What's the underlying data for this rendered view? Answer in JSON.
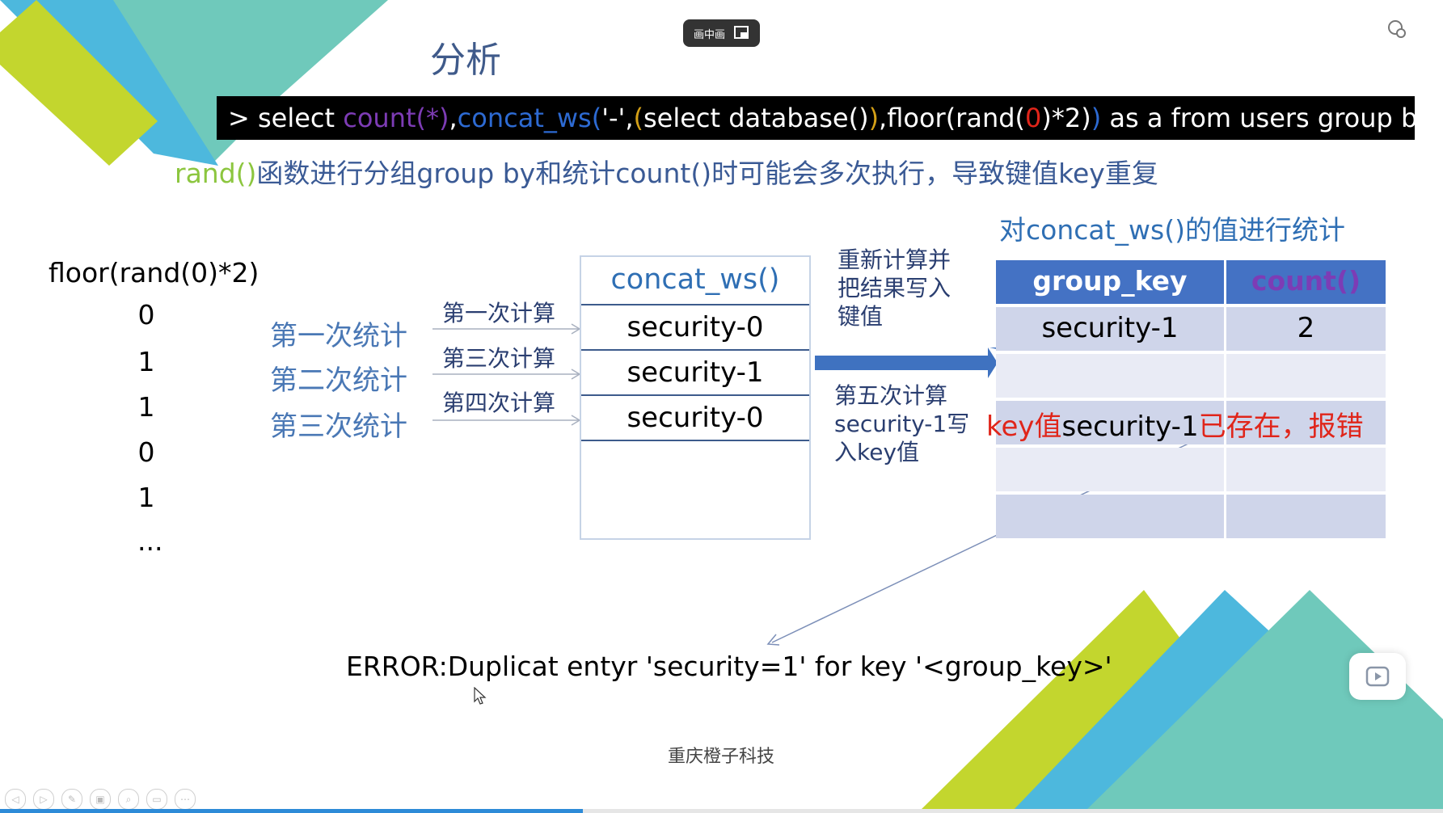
{
  "slide": {
    "title": "分析",
    "pip_label": "画中画",
    "sql": {
      "prefix": "> select ",
      "count": "count(*)",
      "comma1": ",",
      "concat": "concat_ws(",
      "sep": "'-',",
      "open": "(",
      "select_db": "select database()",
      "close": ")",
      "floor_a": ",floor(rand(",
      "zero": "0",
      "floor_b": ")*2)",
      "close2": ")",
      "suffix": " as a from users group by a;"
    },
    "subtitle_rand": "rand()",
    "subtitle_rest": "函数进行分组group by和统计count()时可能会多次执行，导致键值key重复",
    "floor_header": "floor(rand(0)*2)",
    "floor_values": [
      "0",
      "1",
      "1",
      "0",
      "1",
      "..."
    ],
    "stat_labels": [
      "第一次统计",
      "第二次统计",
      "第三次统计"
    ],
    "calc_labels": [
      "第一次计算",
      "第三次计算",
      "第四次计算"
    ],
    "concat_header": "concat_ws()",
    "concat_rows": [
      "security-0",
      "security-1",
      "security-0"
    ],
    "recalc_label_lines": [
      "重新计算并",
      "把结果写入",
      "键值"
    ],
    "fifth_calc_lines": [
      "第五次计算",
      "security-1写",
      "入key值"
    ],
    "table_title": "对concat_ws()的值进行统计",
    "table_headers": [
      "group_key",
      "count()"
    ],
    "table_rows": [
      [
        "security-1",
        "2"
      ]
    ],
    "key_exists": {
      "a": "key值",
      "b": "security-1",
      "c": "已存在，报错"
    },
    "error_text": "ERROR:Duplicat entyr 'security=1' for key '<group_key>'",
    "footer": "重庆橙子科技"
  },
  "colors": {
    "lime": "#c3d62e",
    "cyan": "#4db8dd",
    "teal": "#6fc9bb",
    "header_blue": "#4472c4",
    "row_dark": "#cfd5ea",
    "row_light": "#e9ebf5",
    "error_red": "#e0251a",
    "count_header_purple": "#7d3cb5"
  },
  "icons": [
    "pip-exit-icon",
    "settings-icon",
    "play-icon",
    "prev-icon",
    "next-icon",
    "pen-icon",
    "pages-icon",
    "zoom-icon",
    "screen-icon",
    "more-icon"
  ],
  "playback_progress": 0.404
}
